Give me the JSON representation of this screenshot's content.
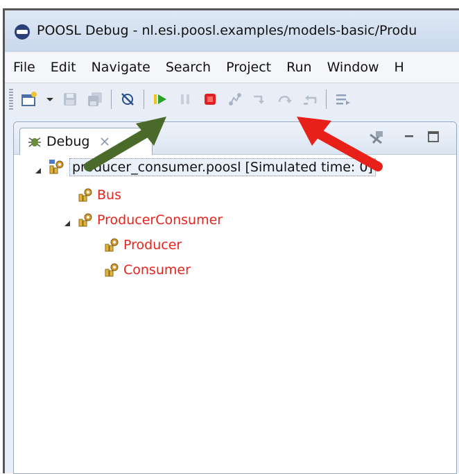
{
  "window": {
    "title": "POOSL Debug - nl.esi.poosl.examples/models-basic/Produ"
  },
  "menu": {
    "items": [
      "File",
      "Edit",
      "Navigate",
      "Search",
      "Project",
      "Run",
      "Window",
      "H"
    ]
  },
  "toolbar": {
    "icons": [
      "new-wizard-icon",
      "dropdown-arrow-icon",
      "save-icon",
      "save-all-icon",
      "skip-breakpoints-icon",
      "resume-icon",
      "suspend-icon",
      "terminate-icon",
      "disconnect-icon",
      "step-into-icon",
      "step-over-icon",
      "step-return-icon",
      "drop-to-frame-icon"
    ]
  },
  "debug_view": {
    "tab_label": "Debug",
    "tree": {
      "root": "producer_consumer.poosl [Simulated time: 0]",
      "children": [
        {
          "label": "Bus"
        },
        {
          "label": "ProducerConsumer",
          "children": [
            {
              "label": "Producer"
            },
            {
              "label": "Consumer"
            }
          ]
        }
      ]
    }
  },
  "colors": {
    "process_label": "#e8231c",
    "arrow_green": "#4a6a2a",
    "arrow_red": "#e8201a",
    "resume_green": "#2aa22a",
    "terminate_red": "#e02020"
  }
}
